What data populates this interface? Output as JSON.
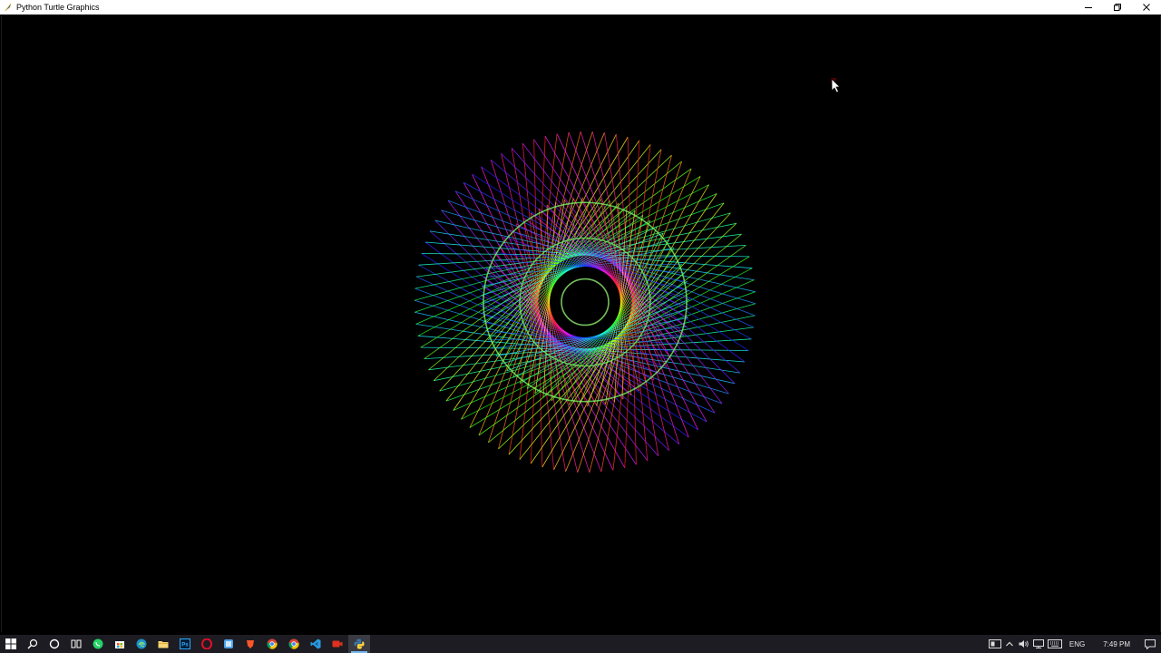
{
  "window": {
    "title": "Python Turtle Graphics",
    "controls": [
      "minimize",
      "restore",
      "close"
    ]
  },
  "canvas": {
    "background": "#000000",
    "drawing": "spirograph",
    "colors": [
      "#ff3c50",
      "#3cff50",
      "#5a3cff",
      "#ff50c8",
      "#b4ffb4"
    ]
  },
  "taskbar": {
    "apps": [
      {
        "name": "start",
        "icon": "windows-logo-icon"
      },
      {
        "name": "search",
        "icon": "search-icon"
      },
      {
        "name": "cortana",
        "icon": "circle-icon"
      },
      {
        "name": "task-view",
        "icon": "task-view-icon"
      },
      {
        "name": "whatsapp",
        "icon": "whatsapp-icon"
      },
      {
        "name": "store",
        "icon": "store-icon"
      },
      {
        "name": "edge",
        "icon": "edge-icon"
      },
      {
        "name": "file-explorer",
        "icon": "folder-icon"
      },
      {
        "name": "photoshop",
        "icon": "photoshop-icon"
      },
      {
        "name": "opera",
        "icon": "opera-icon"
      },
      {
        "name": "app-blue",
        "icon": "blue-app-icon"
      },
      {
        "name": "brave",
        "icon": "brave-icon"
      },
      {
        "name": "chrome",
        "icon": "chrome-icon"
      },
      {
        "name": "chrome-2",
        "icon": "chrome-icon"
      },
      {
        "name": "vscode",
        "icon": "vscode-icon"
      },
      {
        "name": "recorder",
        "icon": "recorder-icon"
      },
      {
        "name": "python",
        "icon": "python-icon",
        "active": true
      }
    ],
    "tray": {
      "language": "ENG",
      "time": "7:49 PM"
    }
  }
}
